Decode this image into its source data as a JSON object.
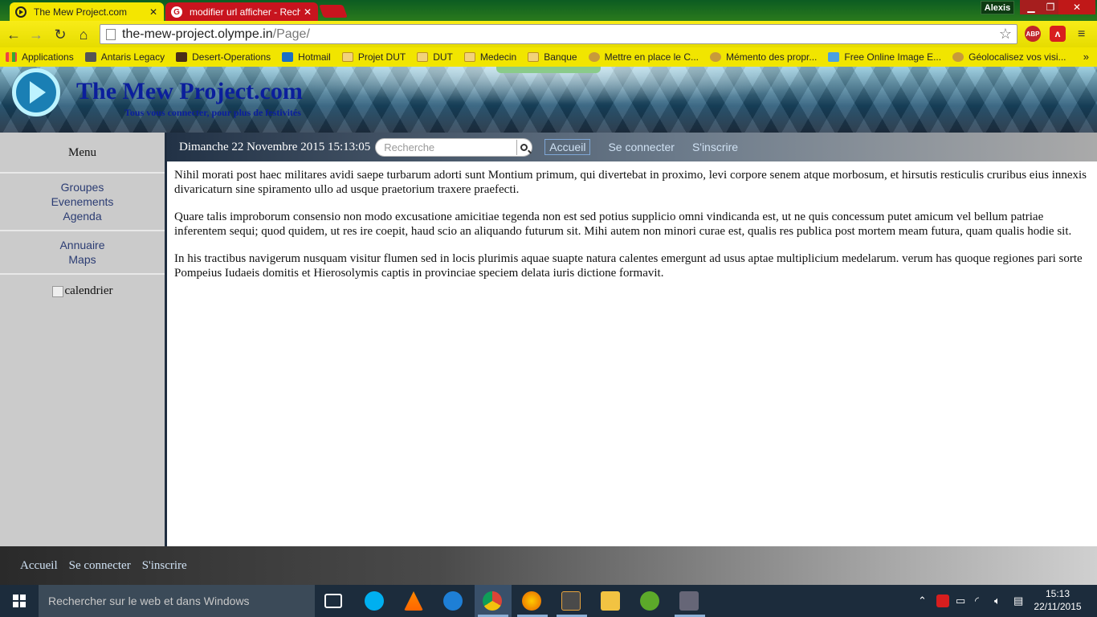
{
  "browser": {
    "tabs": [
      {
        "label": "The Mew Project.com",
        "active": true
      },
      {
        "label": "modifier url afficher - Rech",
        "active": false
      }
    ],
    "user": "Alexis",
    "url_host": "the-mew-project.olympe.in",
    "url_path": "/Page/",
    "extensions": [
      "ABP",
      "Avira"
    ],
    "bookmarks": [
      {
        "label": "Applications",
        "icon": "apps-icon"
      },
      {
        "label": "Antaris Legacy",
        "icon": "antaris-icon"
      },
      {
        "label": "Desert-Operations",
        "icon": "desert-icon"
      },
      {
        "label": "Hotmail",
        "icon": "outlook-icon"
      },
      {
        "label": "Projet DUT",
        "icon": "folder-icon"
      },
      {
        "label": "DUT",
        "icon": "folder-icon"
      },
      {
        "label": "Medecin",
        "icon": "folder-icon"
      },
      {
        "label": "Banque",
        "icon": "folder-icon"
      },
      {
        "label": "Mettre en place le C...",
        "icon": "gear-icon"
      },
      {
        "label": "Mémento des propr...",
        "icon": "gear-icon"
      },
      {
        "label": "Free Online Image E...",
        "icon": "image-icon"
      },
      {
        "label": "Géolocalisez vos visi...",
        "icon": "gear-icon"
      }
    ]
  },
  "site": {
    "title": "The Mew Project.com",
    "subtitle": "Tous vous connecter, pour plus de festivités",
    "sidebar": {
      "menu_title": "Menu",
      "group1": [
        "Groupes",
        "Evenements",
        "Agenda"
      ],
      "group2": [
        "Annuaire",
        "Maps"
      ],
      "calendar_alt": "calendrier"
    },
    "navbar": {
      "date": "Dimanche 22 Novembre 2015 15:13:05",
      "search_placeholder": "Recherche",
      "links": [
        "Accueil",
        "Se connecter",
        "S'inscrire"
      ]
    },
    "content": {
      "paragraphs": [
        "Nihil morati post haec militares avidi saepe turbarum adorti sunt Montium primum, qui divertebat in proximo, levi corpore senem atque morbosum, et hirsutis resticulis cruribus eius innexis divaricaturn sine spiramento ullo ad usque praetorium traxere praefecti.",
        "Quare talis improborum consensio non modo excusatione amicitiae tegenda non est sed potius supplicio omni vindicanda est, ut ne quis concessum putet amicum vel bellum patriae inferentem sequi; quod quidem, ut res ire coepit, haud scio an aliquando futurum sit. Mihi autem non minori curae est, qualis res publica post mortem meam futura, quam qualis hodie sit.",
        "In his tractibus navigerum nusquam visitur flumen sed in locis plurimis aquae suapte natura calentes emergunt ad usus aptae multiplicium medelarum. verum has quoque regiones pari sorte Pompeius Iudaeis domitis et Hierosolymis captis in provinciae speciem delata iuris dictione formavit."
      ]
    },
    "footer": {
      "links": [
        "Accueil",
        "Se connecter",
        "S'inscrire"
      ]
    }
  },
  "taskbar": {
    "search_placeholder": "Rechercher sur le web et dans Windows",
    "time": "15:13",
    "date": "22/11/2015"
  },
  "colors": {
    "site_title": "#0b1e9c",
    "tab_active": "#f4e600",
    "tab_inactive": "#c8141e",
    "nav_link": "#cfe1f3"
  }
}
